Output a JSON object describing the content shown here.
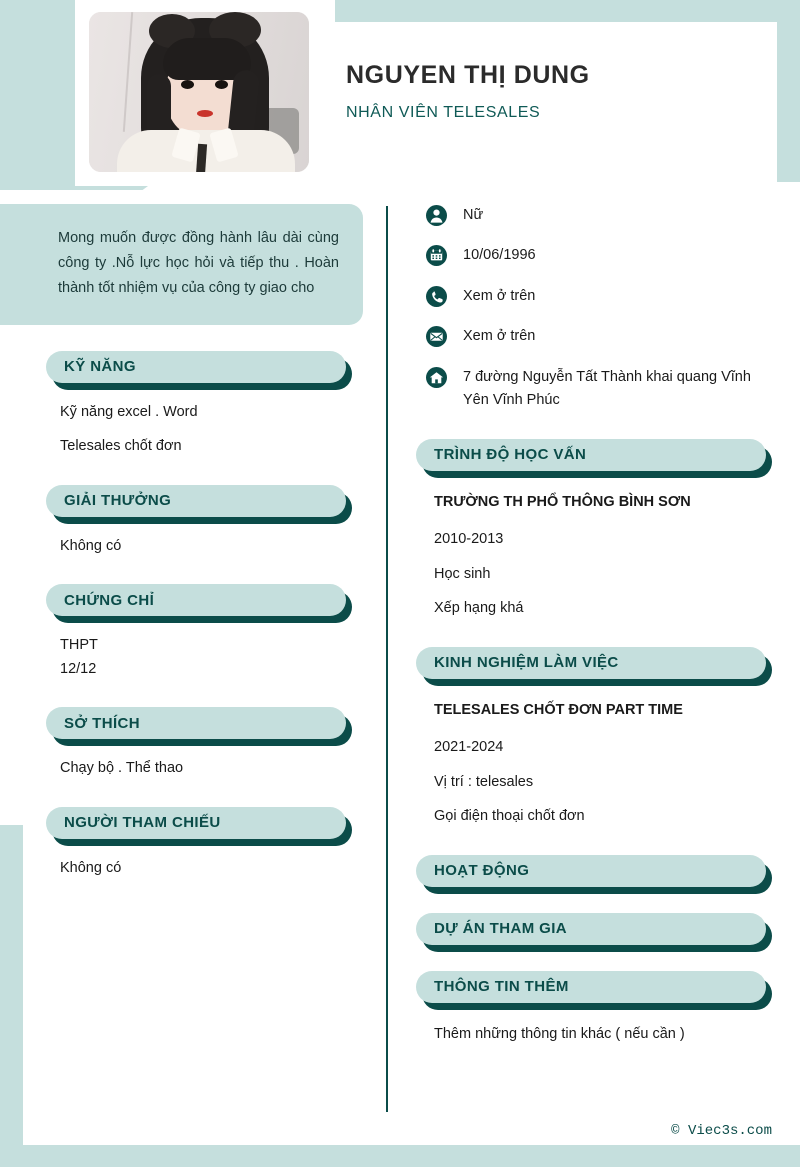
{
  "colors": {
    "mint": "#c5dfdd",
    "teal_dark": "#0b4c49",
    "accent_text": "#0f5a56",
    "body_text": "#1a1a1a"
  },
  "header": {
    "name": "NGUYEN THỊ DUNG",
    "job_title": "NHÂN VIÊN TELESALES",
    "photo_alt": "profile-photo"
  },
  "summary": {
    "text": "Mong muốn được đồng hành lâu dài cùng công ty .Nỗ lực học hỏi và tiếp thu . Hoàn thành tốt nhiệm vụ của công ty giao cho"
  },
  "contact": [
    {
      "icon": "person-icon",
      "value": "Nữ"
    },
    {
      "icon": "calendar-icon",
      "value": "10/06/1996"
    },
    {
      "icon": "phone-icon",
      "value": "Xem ở trên"
    },
    {
      "icon": "envelope-icon",
      "value": "Xem ở trên"
    },
    {
      "icon": "home-icon",
      "value": "7 đường Nguyễn Tất Thành khai quang Vĩnh Yên Vĩnh Phúc"
    }
  ],
  "left_sections": [
    {
      "title": "KỸ NĂNG",
      "lines": [
        "Kỹ năng excel . Word",
        "Telesales chốt đơn"
      ]
    },
    {
      "title": "GIẢI THƯỞNG",
      "lines": [
        "Không có"
      ]
    },
    {
      "title": "CHỨNG CHỈ",
      "lines": [
        "THPT",
        "12/12"
      ]
    },
    {
      "title": "SỞ THÍCH",
      "lines": [
        "Chạy bộ . Thể thao"
      ]
    },
    {
      "title": "NGƯỜI THAM CHIẾU",
      "lines": [
        "Không có"
      ]
    }
  ],
  "right_sections": [
    {
      "title": "TRÌNH ĐỘ HỌC VẤN",
      "heading": "TRƯỜNG TH PHỔ THÔNG BÌNH SƠN",
      "lines": [
        "2010-2013",
        "Học sinh",
        "Xếp hạng khá"
      ]
    },
    {
      "title": "KINH NGHIỆM LÀM VIỆC",
      "heading": "TELESALES CHỐT ĐƠN PART TIME",
      "lines": [
        "2021-2024",
        "Vị trí : telesales",
        "Gọi điện thoại chốt đơn"
      ]
    },
    {
      "title": "HOẠT ĐỘNG",
      "heading": "",
      "lines": []
    },
    {
      "title": "DỰ ÁN THAM GIA",
      "heading": "",
      "lines": []
    },
    {
      "title": "THÔNG TIN THÊM",
      "heading": "",
      "lines": [
        "Thêm những thông tin khác ( nếu cần )"
      ]
    }
  ],
  "footer": {
    "copyright": "© Viec3s.com"
  }
}
